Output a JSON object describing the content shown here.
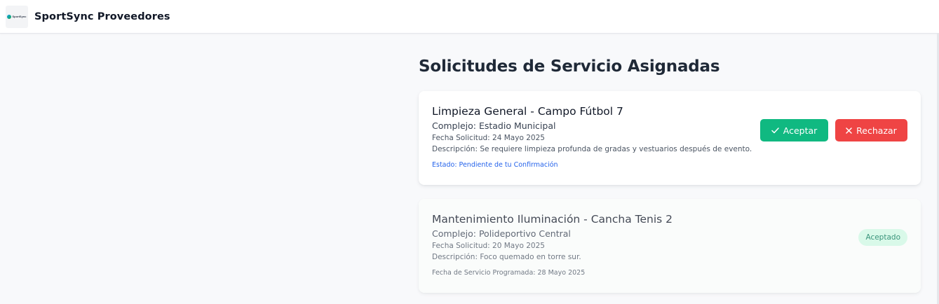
{
  "app": {
    "logo_text": "SportSync",
    "title": "SportSync Proveedores"
  },
  "page": {
    "title": "Solicitudes de Servicio Asignadas"
  },
  "requests": [
    {
      "title": "Limpieza General - Campo Fútbol 7",
      "complex": "Complejo: Estadio Municipal",
      "date": "Fecha Solicitud: 24 Mayo 2025",
      "description": "Descripción: Se requiere limpieza profunda de gradas y vestuarios después de evento.",
      "status": "Estado: Pendiente de tu Confirmación",
      "accept_label": "Aceptar",
      "reject_label": "Rechazar"
    },
    {
      "title": "Mantenimiento Iluminación - Cancha Tenis 2",
      "complex": "Complejo: Polideportivo Central",
      "date": "Fecha Solicitud: 20 Mayo 2025",
      "description": "Descripción: Foco quemado en torre sur.",
      "scheduled": "Fecha de Servicio Programada: 28 Mayo 2025",
      "badge": "Aceptado"
    }
  ],
  "colors": {
    "accept": "#10b981",
    "reject": "#ef4444",
    "status_link": "#2563eb",
    "badge_bg": "#d1fae5",
    "badge_text": "#047857"
  }
}
